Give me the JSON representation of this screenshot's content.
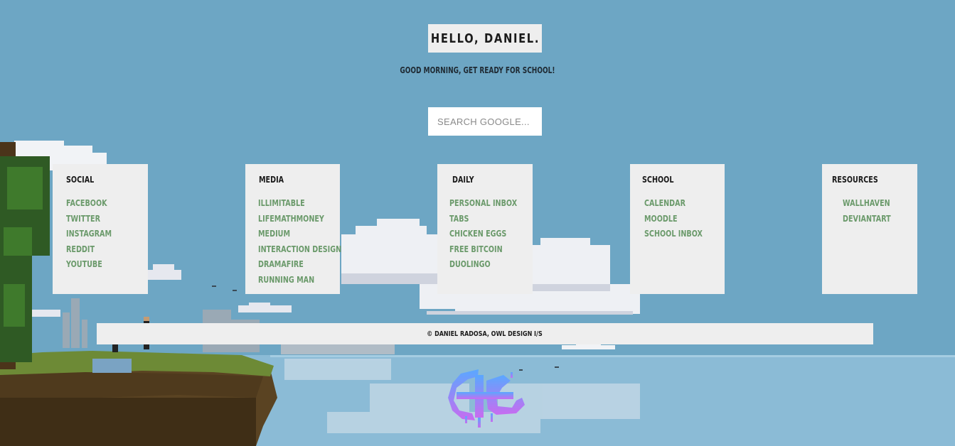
{
  "header": {
    "greeting": "HELLO, DANIEL.",
    "subtitle": "GOOD MORNING, GET READY FOR SCHOOL!"
  },
  "search": {
    "placeholder": "SEARCH GOOGLE..."
  },
  "columns": [
    {
      "title": "SOCIAL",
      "links": [
        "FACEBOOK",
        "TWITTER",
        "INSTAGRAM",
        "REDDIT",
        "YOUTUBE"
      ]
    },
    {
      "title": "MEDIA",
      "links": [
        "ILLIMITABLE",
        "LIFEMATHMONEY",
        "MEDIUM",
        "INTERACTION DESIGN",
        "DRAMAFIRE",
        "RUNNING MAN"
      ]
    },
    {
      "title": "DAILY",
      "links": [
        "PERSONAL INBOX",
        "TABS",
        "CHICKEN EGGS",
        "FREE BITCOIN",
        "DUOLINGO"
      ]
    },
    {
      "title": "SCHOOL",
      "links": [
        "CALENDAR",
        "MOODLE",
        "SCHOOL INBOX"
      ]
    },
    {
      "title": "RESOURCES",
      "links": [
        "WALLHAVEN",
        "DEVIANTART"
      ]
    }
  ],
  "footer": {
    "text": "© DANIEL RADOSA, OWL DESIGN I/S"
  },
  "colors": {
    "sky": "#6da6c4",
    "water": "#8bbbd6",
    "card_bg": "#eeeeee",
    "link": "#6b9a6b",
    "heading": "#1a1a1a",
    "logo_gradient": [
      "#5aa8ff",
      "#c86cf0"
    ]
  },
  "icons": {
    "logo": "owl-design-logo-icon"
  }
}
